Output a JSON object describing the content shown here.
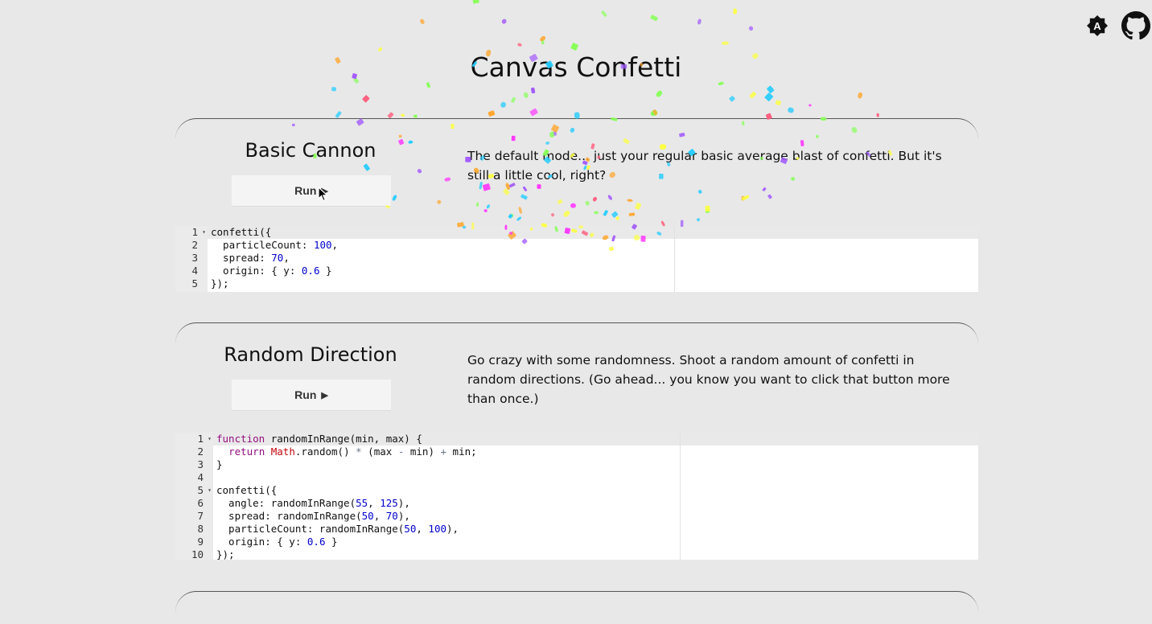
{
  "page": {
    "title": "Canvas Confetti"
  },
  "header": {
    "theme_icon": "theme-toggle-icon",
    "github_icon": "github-icon"
  },
  "sections": [
    {
      "title": "Basic Cannon",
      "run_label": "Run",
      "description": "The default mode... just your regular basic average blast of confetti. But it's still a little cool, right?",
      "code_lines": [
        "1",
        "2",
        "3",
        "4",
        "5"
      ]
    },
    {
      "title": "Random Direction",
      "run_label": "Run",
      "description": "Go crazy with some randomness. Shoot a random amount of confetti in random directions. (Go ahead... you know you want to click that button more than once.)",
      "code_lines": [
        "1",
        "2",
        "3",
        "4",
        "5",
        "6",
        "7",
        "8",
        "9",
        "10"
      ]
    }
  ],
  "code": {
    "basic": [
      "confetti({",
      "  particleCount: 100,",
      "  spread: 70,",
      "  origin: { y: 0.6 }",
      "});"
    ],
    "random": [
      "function randomInRange(min, max) {",
      "  return Math.random() * (max - min) + min;",
      "}",
      "",
      "confetti({",
      "  angle: randomInRange(55, 125),",
      "  spread: randomInRange(50, 70),",
      "  particleCount: randomInRange(50, 100),",
      "  origin: { y: 0.6 }",
      "});"
    ]
  },
  "colors": {
    "background": "#e8e8e8",
    "keyword": "#930f80",
    "number": "#0000cd",
    "builtin": "#c5060b",
    "confetti": [
      "#26ccff",
      "#a25afd",
      "#ff5e7e",
      "#88ff5a",
      "#fcff42",
      "#ffa62d",
      "#ff36ff"
    ]
  }
}
